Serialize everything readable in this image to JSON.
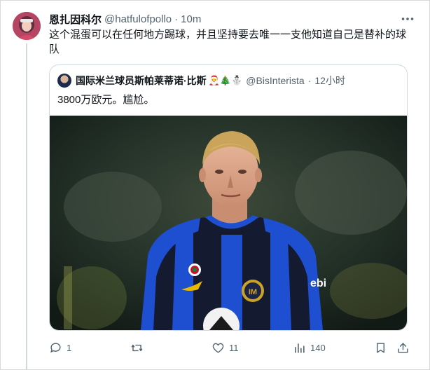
{
  "tweet": {
    "display_name": "恩扎因科尔",
    "handle": "@hatfulofpollo",
    "separator": "·",
    "time": "10m",
    "text": "这个混蛋可以在任何地方踢球，并且坚持要去唯一一支他知道自己是替补的球队"
  },
  "quote": {
    "display_name": "国际米兰球员斯帕莱蒂诺·比斯",
    "emojis": "🎅🎄⛄",
    "handle": "@BisInterista",
    "separator": "·",
    "time": "12小时",
    "text": "3800万欧元。尴尬。",
    "image": {
      "subject": "player-photo",
      "shirt_sponsor": "ebi"
    }
  },
  "actions": {
    "reply_count": "1",
    "retweet_count": "",
    "like_count": "11",
    "views_count": "140"
  },
  "icons": {
    "more": "more-horizontal-icon",
    "reply": "reply-icon",
    "retweet": "retweet-icon",
    "like": "heart-icon",
    "views": "views-chart-icon",
    "bookmark": "bookmark-icon",
    "share": "share-icon"
  },
  "colors": {
    "text_primary": "#0f1419",
    "text_secondary": "#536471",
    "border": "#cfd9de",
    "inter_blue": "#1e4fd1"
  }
}
